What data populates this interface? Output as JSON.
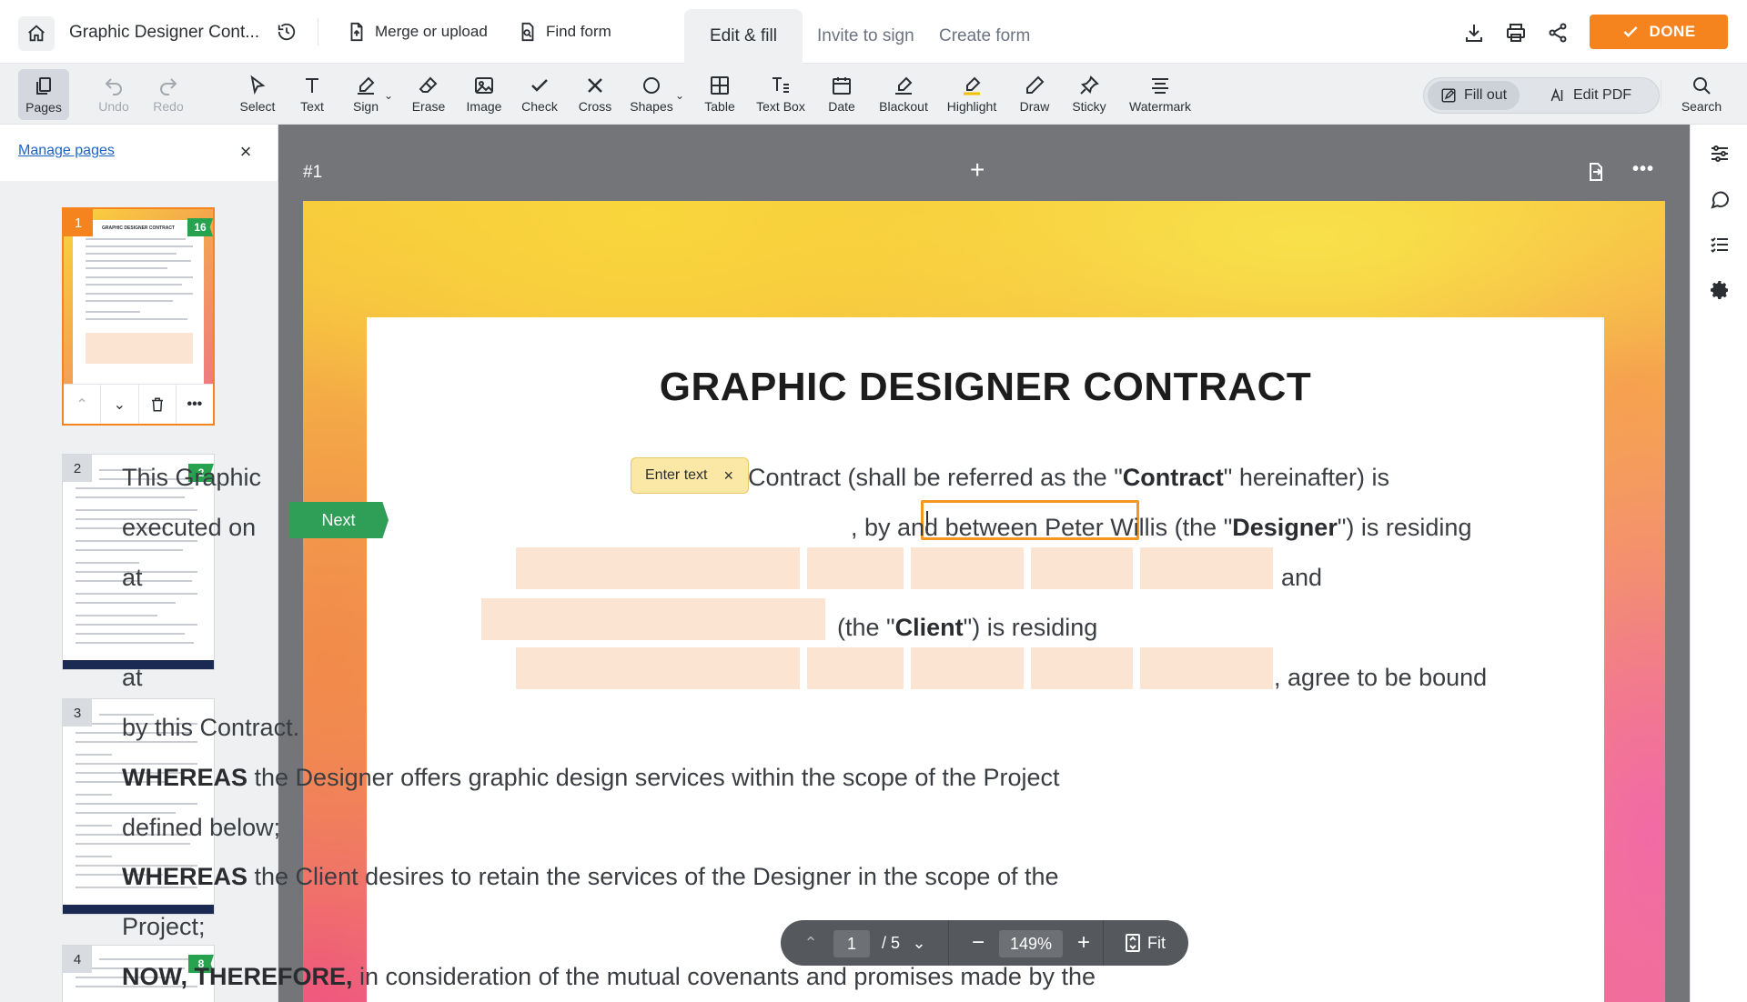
{
  "header": {
    "doc_title": "Graphic Designer Cont...",
    "merge_label": "Merge or upload",
    "find_form_label": "Find form",
    "tabs": [
      {
        "label": "Edit & fill",
        "active": true
      },
      {
        "label": "Invite to sign",
        "active": false
      },
      {
        "label": "Create form",
        "active": false
      }
    ],
    "done_label": "DONE"
  },
  "toolbar": {
    "pages": "Pages",
    "undo": "Undo",
    "redo": "Redo",
    "select": "Select",
    "text": "Text",
    "sign": "Sign",
    "erase": "Erase",
    "image": "Image",
    "check": "Check",
    "cross": "Cross",
    "shapes": "Shapes",
    "table": "Table",
    "text_box": "Text Box",
    "date": "Date",
    "blackout": "Blackout",
    "highlight": "Highlight",
    "draw": "Draw",
    "sticky": "Sticky",
    "watermark": "Watermark",
    "fill_out": "Fill out",
    "edit_pdf": "Edit PDF",
    "search": "Search"
  },
  "left_panel": {
    "manage_pages": "Manage pages",
    "close": "×",
    "thumbnails": [
      {
        "num": "1",
        "badge": "16",
        "title": "GRAPHIC DESIGNER CONTRACT"
      },
      {
        "num": "2",
        "badge": "2"
      },
      {
        "num": "3",
        "badge": ""
      },
      {
        "num": "4",
        "badge": "8"
      }
    ]
  },
  "canvas": {
    "page_label": "#1",
    "add_page": "+",
    "next_label": "Next",
    "tooltip_label": "Enter text",
    "tooltip_close": "×"
  },
  "document": {
    "heading": "GRAPHIC DESIGNER CONTRACT",
    "l1_a": "This Graphic",
    "l1_b": "Contract (shall be referred as the \"",
    "l1_bold": "Contract",
    "l1_c": "\" hereinafter) is",
    "l2_a": "executed on",
    "l2_b": ", by and between Peter Willis (the \"",
    "l2_bold": "Designer",
    "l2_c": "\") is residing",
    "l3_a": "at",
    "l3_b": "and",
    "l4_a": "(the \"",
    "l4_bold": "Client",
    "l4_b": "\") is residing",
    "l5_a": "at",
    "l5_b": ", agree to be bound",
    "l6": "by this Contract.",
    "l7_bold": "WHEREAS",
    "l7": " the Designer offers graphic design services within the scope of the Project",
    "l8": "defined below;",
    "l9_bold": "WHEREAS",
    "l9": " the Client desires to retain the services of the Designer in the scope of the",
    "l10": "Project;",
    "l11_bold": "NOW, THEREFORE,",
    "l11": " in consideration of the mutual covenants and promises made by the"
  },
  "pager": {
    "current": "1",
    "total": "/ 5",
    "zoom": "149%",
    "fit": "Fit"
  },
  "colors": {
    "accent": "#f5841f",
    "next_green": "#2f9e57",
    "badge_green": "#27a34f",
    "placeholder_fill": "#fbe5d2",
    "link_blue": "#1d63c7"
  }
}
